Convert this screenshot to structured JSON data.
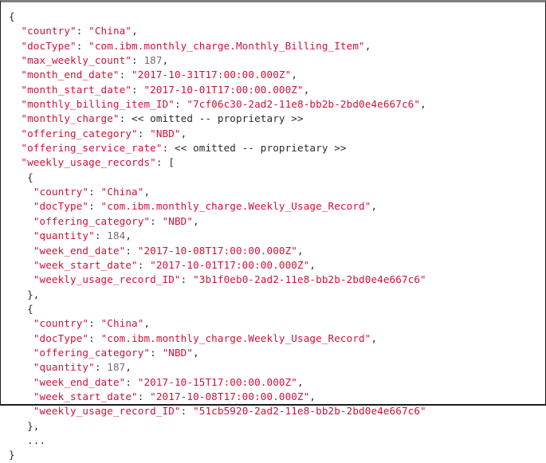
{
  "document": {
    "kind": "json-code-listing",
    "language": "JSON",
    "colors": {
      "key": "#cd1239",
      "string": "#cd1239",
      "number": "#6e6e6e",
      "punctuation": "#2a2a2a",
      "omitted": "#2a2a2a",
      "background": "#ffffff",
      "border_top": "#808080",
      "border": "#1c1c1c"
    },
    "omitted_marker": "<< omitted -- proprietary >>",
    "ellipsis": "...",
    "lines": [
      {
        "indent": 0,
        "tokens": [
          {
            "t": "p",
            "v": "{"
          }
        ]
      },
      {
        "indent": 1,
        "tokens": [
          {
            "t": "k",
            "v": "\"country\""
          },
          {
            "t": "p",
            "v": ": "
          },
          {
            "t": "s",
            "v": "\"China\""
          },
          {
            "t": "p",
            "v": ","
          }
        ]
      },
      {
        "indent": 1,
        "tokens": [
          {
            "t": "k",
            "v": "\"docType\""
          },
          {
            "t": "p",
            "v": ": "
          },
          {
            "t": "s",
            "v": "\"com.ibm.monthly_charge.Monthly_Billing_Item\""
          },
          {
            "t": "p",
            "v": ","
          }
        ]
      },
      {
        "indent": 1,
        "tokens": [
          {
            "t": "k",
            "v": "\"max_weekly_count\""
          },
          {
            "t": "p",
            "v": ": "
          },
          {
            "t": "n",
            "v": "187"
          },
          {
            "t": "p",
            "v": ","
          }
        ]
      },
      {
        "indent": 1,
        "tokens": [
          {
            "t": "k",
            "v": "\"month_end_date\""
          },
          {
            "t": "p",
            "v": ": "
          },
          {
            "t": "s",
            "v": "\"2017-10-31T17:00:00.000Z\""
          },
          {
            "t": "p",
            "v": ","
          }
        ]
      },
      {
        "indent": 1,
        "tokens": [
          {
            "t": "k",
            "v": "\"month_start_date\""
          },
          {
            "t": "p",
            "v": ": "
          },
          {
            "t": "s",
            "v": "\"2017-10-01T17:00:00.000Z\""
          },
          {
            "t": "p",
            "v": ","
          }
        ]
      },
      {
        "indent": 1,
        "tokens": [
          {
            "t": "k",
            "v": "\"monthly_billing_item_ID\""
          },
          {
            "t": "p",
            "v": ": "
          },
          {
            "t": "s",
            "v": "\"7cf06c30-2ad2-11e8-bb2b-2bd0e4e667c6\""
          },
          {
            "t": "p",
            "v": ","
          }
        ]
      },
      {
        "indent": 1,
        "tokens": [
          {
            "t": "k",
            "v": "\"monthly_charge\""
          },
          {
            "t": "p",
            "v": ": "
          },
          {
            "t": "om",
            "v": "<< omitted -- proprietary >>"
          }
        ]
      },
      {
        "indent": 1,
        "tokens": [
          {
            "t": "k",
            "v": "\"offering_category\""
          },
          {
            "t": "p",
            "v": ": "
          },
          {
            "t": "s",
            "v": "\"NBD\""
          },
          {
            "t": "p",
            "v": ","
          }
        ]
      },
      {
        "indent": 1,
        "tokens": [
          {
            "t": "k",
            "v": "\"offering_service_rate\""
          },
          {
            "t": "p",
            "v": ": "
          },
          {
            "t": "om",
            "v": "<< omitted -- proprietary >>"
          }
        ]
      },
      {
        "indent": 1,
        "tokens": [
          {
            "t": "k",
            "v": "\"weekly_usage_records\""
          },
          {
            "t": "p",
            "v": ": "
          },
          {
            "t": "p",
            "v": "["
          }
        ]
      },
      {
        "indent": 1.5,
        "tokens": [
          {
            "t": "p",
            "v": "{"
          }
        ]
      },
      {
        "indent": 2,
        "tokens": [
          {
            "t": "k",
            "v": "\"country\""
          },
          {
            "t": "p",
            "v": ": "
          },
          {
            "t": "s",
            "v": "\"China\""
          },
          {
            "t": "p",
            "v": ","
          }
        ]
      },
      {
        "indent": 2,
        "tokens": [
          {
            "t": "k",
            "v": "\"docType\""
          },
          {
            "t": "p",
            "v": ": "
          },
          {
            "t": "s",
            "v": "\"com.ibm.monthly_charge.Weekly_Usage_Record\""
          },
          {
            "t": "p",
            "v": ","
          }
        ]
      },
      {
        "indent": 2,
        "tokens": [
          {
            "t": "k",
            "v": "\"offering_category\""
          },
          {
            "t": "p",
            "v": ": "
          },
          {
            "t": "s",
            "v": "\"NBD\""
          },
          {
            "t": "p",
            "v": ","
          }
        ]
      },
      {
        "indent": 2,
        "tokens": [
          {
            "t": "k",
            "v": "\"quantity\""
          },
          {
            "t": "p",
            "v": ": "
          },
          {
            "t": "n",
            "v": "184"
          },
          {
            "t": "p",
            "v": ","
          }
        ]
      },
      {
        "indent": 2,
        "tokens": [
          {
            "t": "k",
            "v": "\"week_end_date\""
          },
          {
            "t": "p",
            "v": ": "
          },
          {
            "t": "s",
            "v": "\"2017-10-08T17:00:00.000Z\""
          },
          {
            "t": "p",
            "v": ","
          }
        ]
      },
      {
        "indent": 2,
        "tokens": [
          {
            "t": "k",
            "v": "\"week_start_date\""
          },
          {
            "t": "p",
            "v": ": "
          },
          {
            "t": "s",
            "v": "\"2017-10-01T17:00:00.000Z\""
          },
          {
            "t": "p",
            "v": ","
          }
        ]
      },
      {
        "indent": 2,
        "tokens": [
          {
            "t": "k",
            "v": "\"weekly_usage_record_ID\""
          },
          {
            "t": "p",
            "v": ": "
          },
          {
            "t": "s",
            "v": "\"3b1f0eb0-2ad2-11e8-bb2b-2bd0e4e667c6\""
          }
        ]
      },
      {
        "indent": 1.5,
        "tokens": [
          {
            "t": "p",
            "v": "},"
          }
        ]
      },
      {
        "indent": 1.5,
        "tokens": [
          {
            "t": "p",
            "v": "{"
          }
        ]
      },
      {
        "indent": 2,
        "tokens": [
          {
            "t": "k",
            "v": "\"country\""
          },
          {
            "t": "p",
            "v": ": "
          },
          {
            "t": "s",
            "v": "\"China\""
          },
          {
            "t": "p",
            "v": ","
          }
        ]
      },
      {
        "indent": 2,
        "tokens": [
          {
            "t": "k",
            "v": "\"docType\""
          },
          {
            "t": "p",
            "v": ": "
          },
          {
            "t": "s",
            "v": "\"com.ibm.monthly_charge.Weekly_Usage_Record\""
          },
          {
            "t": "p",
            "v": ","
          }
        ]
      },
      {
        "indent": 2,
        "tokens": [
          {
            "t": "k",
            "v": "\"offering_category\""
          },
          {
            "t": "p",
            "v": ": "
          },
          {
            "t": "s",
            "v": "\"NBD\""
          },
          {
            "t": "p",
            "v": ","
          }
        ]
      },
      {
        "indent": 2,
        "tokens": [
          {
            "t": "k",
            "v": "\"quantity\""
          },
          {
            "t": "p",
            "v": ": "
          },
          {
            "t": "n",
            "v": "187"
          },
          {
            "t": "p",
            "v": ","
          }
        ]
      },
      {
        "indent": 2,
        "tokens": [
          {
            "t": "k",
            "v": "\"week_end_date\""
          },
          {
            "t": "p",
            "v": ": "
          },
          {
            "t": "s",
            "v": "\"2017-10-15T17:00:00.000Z\""
          },
          {
            "t": "p",
            "v": ","
          }
        ]
      },
      {
        "indent": 2,
        "tokens": [
          {
            "t": "k",
            "v": "\"week_start_date\""
          },
          {
            "t": "p",
            "v": ": "
          },
          {
            "t": "s",
            "v": "\"2017-10-08T17:00:00.000Z\""
          },
          {
            "t": "p",
            "v": ","
          }
        ]
      },
      {
        "indent": 2,
        "tokens": [
          {
            "t": "k",
            "v": "\"weekly_usage_record_ID\""
          },
          {
            "t": "p",
            "v": ": "
          },
          {
            "t": "s",
            "v": "\"51cb5920-2ad2-11e8-bb2b-2bd0e4e667c6\""
          }
        ]
      },
      {
        "indent": 1.5,
        "tokens": [
          {
            "t": "p",
            "v": "},"
          }
        ]
      },
      {
        "indent": 1.5,
        "tokens": [
          {
            "t": "el",
            "v": "..."
          }
        ]
      },
      {
        "indent": 0,
        "tokens": [
          {
            "t": "p",
            "v": "}"
          }
        ]
      }
    ]
  }
}
